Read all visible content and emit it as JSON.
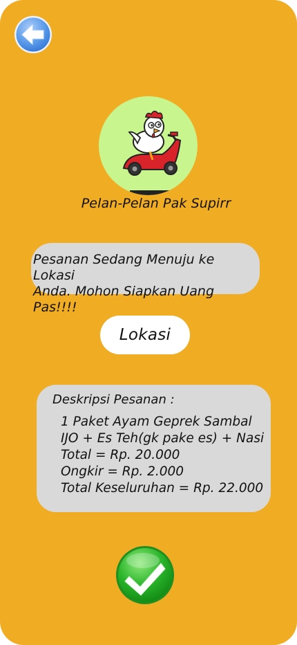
{
  "header": {
    "back_icon": "back-arrow-icon"
  },
  "store": {
    "logo_icon": "chicken-scooter-logo",
    "name": "Pelan-Pelan Pak Supirr"
  },
  "notice": {
    "text": "Pesanan Sedang Menuju ke Lokasi\nAnda. Mohon Siapkan Uang Pas!!!!"
  },
  "location_button": {
    "label": "Lokasi"
  },
  "order": {
    "title": "Deskripsi Pesanan :",
    "lines": [
      "1 Paket Ayam Geprek Sambal",
      "IJO + Es Teh(gk pake es) + Nasi",
      "Total = Rp. 20.000",
      "Ongkir = Rp. 2.000",
      "Total Keseluruhan = Rp. 22.000"
    ]
  },
  "confirm": {
    "icon": "checkmark-icon"
  },
  "colors": {
    "background": "#F0AC22",
    "card": "#D9D9D9",
    "logo_bg": "#C9F58E",
    "confirm_green": "#2BB52B",
    "back_blue": "#5B9BEA"
  }
}
